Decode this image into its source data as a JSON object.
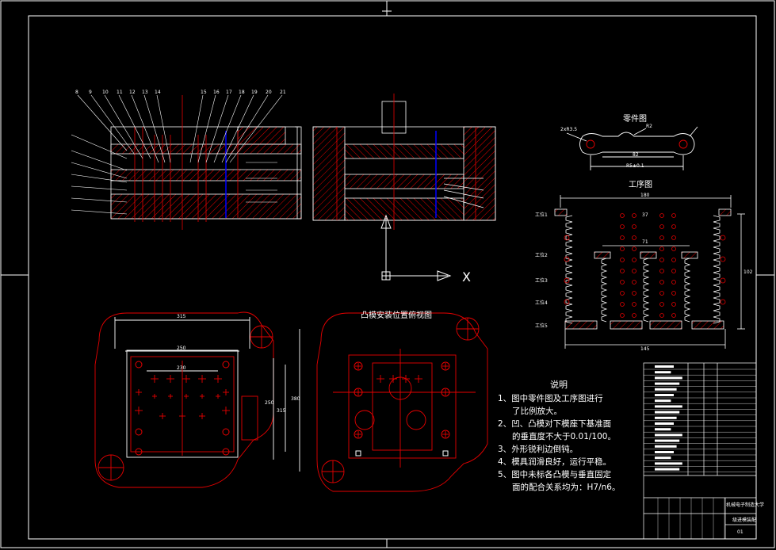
{
  "titles": {
    "part_drawing": "零件图",
    "process_drawing": "工序图",
    "punch_layout": "凸模安装位置俯视图"
  },
  "notes": {
    "heading": "说明",
    "items": [
      {
        "num": "1、",
        "lines": [
          "图中零件图及工序图进行",
          "了比例放大。"
        ]
      },
      {
        "num": "2、",
        "lines": [
          "凹、凸模对下模座下基准面",
          "的垂直度不大于0.01/100。"
        ]
      },
      {
        "num": "3、",
        "lines": [
          "外形锐利边倒钝。"
        ]
      },
      {
        "num": "4、",
        "lines": [
          "模具润滑良好，运行平稳。"
        ]
      },
      {
        "num": "5、",
        "lines": [
          "图中未标各凸模与垂直固定",
          "面的配合关系均为：H7/n6。"
        ]
      }
    ]
  },
  "stations": [
    "工位1",
    "工位2",
    "工位3",
    "工位4",
    "工位5"
  ],
  "ucs_label": "X",
  "dims": {
    "process_width": "180",
    "process_bottom": "145",
    "process_height": "102",
    "process_pitch": "37",
    "process_inner": "71",
    "plate_width": "315",
    "plate_inner": "250",
    "plate_inner2": "230",
    "plate_height": "315",
    "plate_height2": "250",
    "plate_height3": "380",
    "part_len": "82",
    "part_tol": "R5±0.1",
    "part_r": "R2",
    "part_hole": "2xR3.5"
  },
  "balloons": [
    "8",
    "9",
    "10",
    "11",
    "12",
    "13",
    "14",
    "15",
    "16",
    "17",
    "18",
    "19",
    "20",
    "21"
  ],
  "title_block": {
    "school": "机械电子制造大学",
    "name": "级进模装配",
    "sheet": "01"
  },
  "colors": {
    "line": "#ffffff",
    "red": "#e60000",
    "bg": "#000000"
  }
}
